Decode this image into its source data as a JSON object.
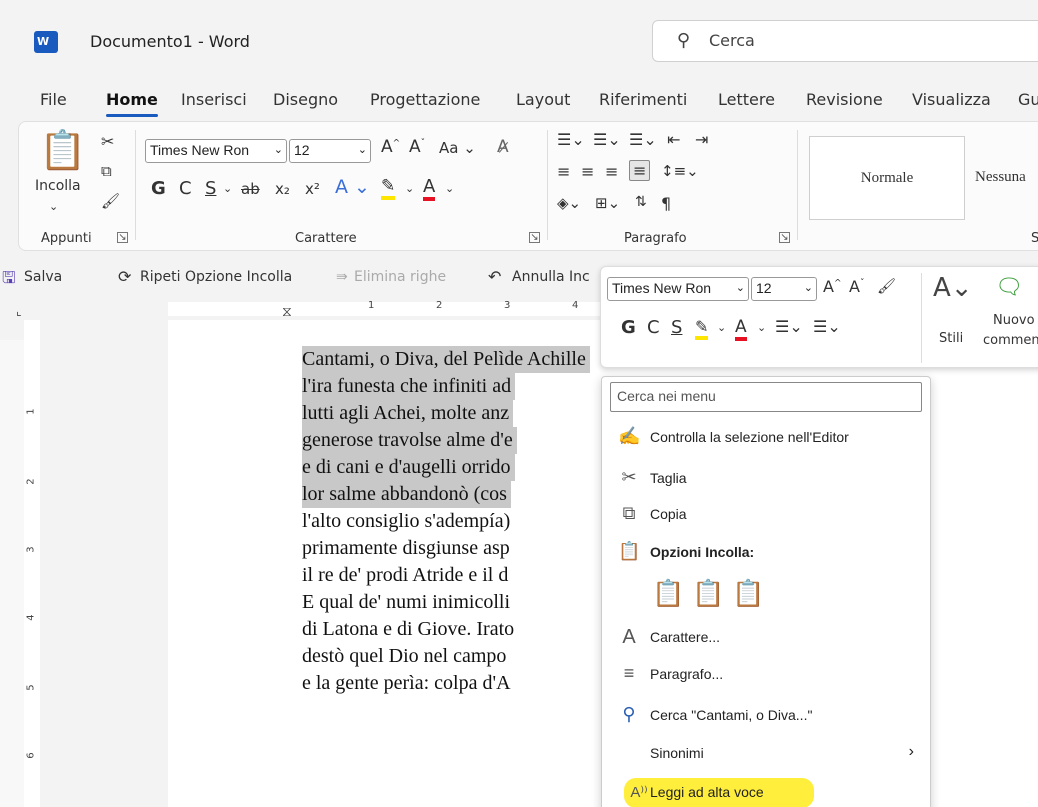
{
  "titlebar": {
    "app_icon_letter": "W",
    "document_title": "Documento1  -  Word",
    "search_placeholder": "Cerca"
  },
  "menu_tabs": [
    "File",
    "Home",
    "Inserisci",
    "Disegno",
    "Progettazione",
    "Layout",
    "Riferimenti",
    "Lettere",
    "Revisione",
    "Visualizza",
    "Gu"
  ],
  "ribbon": {
    "clipboard": {
      "paste_label": "Incolla",
      "group_label": "Appunti"
    },
    "font": {
      "font_name": "Times New Ron",
      "font_size": "12",
      "bold": "G",
      "italic": "C",
      "underline": "S",
      "strike": "ab",
      "subscript": "x₂",
      "superscript": "x²",
      "case_label": "Aa",
      "group_label": "Carattere"
    },
    "paragraph": {
      "group_label": "Paragrafo"
    },
    "styles": {
      "style1": "Normale",
      "style2": "Nessuna",
      "group_label_partial": "S"
    }
  },
  "quick_access": {
    "save": "Salva",
    "repeat": "Ripeti Opzione Incolla",
    "delete_rows": "Elimina righe",
    "undo": "Annulla Inc"
  },
  "ruler": {
    "numbers": [
      "1",
      "2",
      "3",
      "4"
    ],
    "left_numbers": [
      "1",
      "2",
      "3",
      "4",
      "5",
      "6"
    ]
  },
  "document_lines": [
    {
      "text": "Cantami, o Diva, del Pelìde Achille",
      "selected": true
    },
    {
      "text": "l'ira funesta che infiniti ad",
      "selected": true
    },
    {
      "text": "lutti agli Achei, molte anz",
      "selected": true
    },
    {
      "text": "generose travolse alme d'e",
      "selected": true
    },
    {
      "text": "e di cani e d'augelli orrido",
      "selected": true
    },
    {
      "text": "lor salme abbandonò (cos",
      "selected": true
    },
    {
      "text": "l'alto consiglio s'adempía)",
      "selected": false
    },
    {
      "text": "primamente disgiunse asp",
      "selected": false
    },
    {
      "text": "il re de' prodi Atride e il d",
      "selected": false
    },
    {
      "text": "E qual de' numi inimicolli",
      "selected": false
    },
    {
      "text": "di Latona e di Giove. Irato",
      "selected": false
    },
    {
      "text": "destò quel Dio nel campo",
      "selected": false
    },
    {
      "text": "e la gente perìa: colpa d'A",
      "selected": false
    }
  ],
  "mini_toolbar": {
    "font_name": "Times New Ron",
    "font_size": "12",
    "bold": "G",
    "italic": "C",
    "underline": "S",
    "styles_label": "Stili",
    "new_comment_line1": "Nuovo",
    "new_comment_line2": "commen"
  },
  "context_menu": {
    "search_placeholder": "Cerca nei menu",
    "items": [
      {
        "icon": "editor-pen-icon",
        "label": "Controlla la selezione nell'Editor"
      },
      {
        "icon": "scissors-icon",
        "label": "Taglia"
      },
      {
        "icon": "copy-icon",
        "label": "Copia"
      },
      {
        "icon": "clipboard-icon",
        "label": "Opzioni Incolla:"
      },
      {
        "icon": "font-icon",
        "label": "Carattere..."
      },
      {
        "icon": "paragraph-icon",
        "label": "Paragrafo..."
      },
      {
        "icon": "search-icon",
        "label": "Cerca \"Cantami, o Diva...\""
      },
      {
        "icon": "",
        "label": "Sinonimi"
      },
      {
        "icon": "read-aloud-icon",
        "label": "Leggi ad alta voce"
      }
    ],
    "highlight_color": "#ffee3b"
  },
  "colors": {
    "accent": "#185abd",
    "font_color_red": "#e81123",
    "highlight_yellow": "#ffe600"
  }
}
